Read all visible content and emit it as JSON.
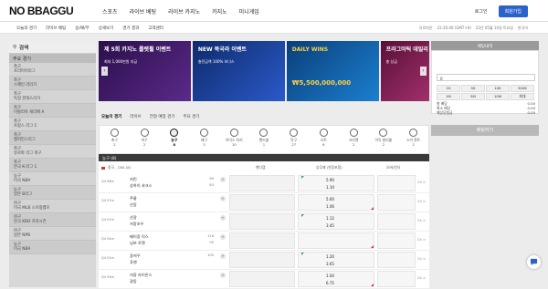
{
  "brand": {
    "logo": "NO BBAGGU"
  },
  "nav": [
    "스포츠",
    "라이브 베팅",
    "라이브 카지노",
    "카지노",
    "미니게임"
  ],
  "auth": {
    "login": "로그인",
    "join": "회원가입"
  },
  "subnav": [
    "오늘의 경기",
    "라이브 베팅",
    "승/패/무",
    "상세보기",
    "경기 결과",
    "고객센터"
  ],
  "subright": [
    "유로피안",
    "22:20:46 (GMT+9)",
    "22년 05월 14일 토요일",
    "한국어"
  ],
  "sidebar": {
    "search": "검색",
    "head": "주요 경기",
    "items": [
      {
        "label": "축구\n프리미어리그",
        "count": ""
      },
      {
        "label": "축구\n스페인 라리가",
        "count": ""
      },
      {
        "label": "축구\n독일 분데스리가",
        "count": ""
      },
      {
        "label": "축구\n이탈리아 세리에 A",
        "count": ""
      },
      {
        "label": "축구\n프랑스 리그 1",
        "count": ""
      },
      {
        "label": "축구\n챔피언스리그",
        "count": ""
      },
      {
        "label": "축구\n유로파 리그 축구",
        "count": ""
      },
      {
        "label": "축구\n한국 K-리그 1",
        "count": ""
      },
      {
        "label": "농구\n미국 NBA",
        "count": ""
      },
      {
        "label": "농구\n일본 B리그",
        "count": ""
      },
      {
        "label": "야구\n미국 MLB 스프링캠프",
        "count": ""
      },
      {
        "label": "야구\n한국 KBO 프리시즌",
        "count": ""
      },
      {
        "label": "야구\n일본 NPB",
        "count": ""
      },
      {
        "label": "농구\n미국 NBA",
        "count": ""
      }
    ]
  },
  "banners": [
    {
      "title": "제 5회 카지노 룰렛휠 이벤트",
      "sub": "최대 1,000만원 지급",
      "color": "#3a1a5c"
    },
    {
      "title": "NEW 북국라 이벤트",
      "sub": "충전금액 100% 보너스",
      "color": "#1e3a8a"
    },
    {
      "title": "DAILY WINS",
      "sub": "₩5,500,000,000",
      "color": "#0e5fa6"
    },
    {
      "title": "프라그마틱 데일리",
      "sub": "총 상금",
      "color": "#7a1a5a"
    }
  ],
  "tabs": [
    "오늘의 경기",
    "라이브",
    "전형 예정 경기",
    "주요 경기"
  ],
  "sports": [
    {
      "name": "축구",
      "count": "2"
    },
    {
      "name": "야구",
      "count": "2"
    },
    {
      "name": "농구",
      "count": "8"
    },
    {
      "name": "배구",
      "count": "3"
    },
    {
      "name": "아이스 하키",
      "count": "10"
    },
    {
      "name": "핸드볼",
      "count": "1"
    },
    {
      "name": "탁구",
      "count": "27"
    },
    {
      "name": "다트",
      "count": "6"
    },
    {
      "name": "크리켓",
      "count": "2"
    },
    {
      "name": "이익 발리볼",
      "count": "2"
    },
    {
      "name": "스키 퀸트",
      "count": "2"
    }
  ],
  "league_bar": "농구 (8)",
  "table_head": {
    "league": "중국 - CBA (8)",
    "col1": "핸디캡",
    "col2": "승무패 (연장포함)",
    "col3": "오버/언더"
  },
  "games": [
    {
      "time": "Q4 08m",
      "home": "지린",
      "away": "상하이 샤크스",
      "s1": "80",
      "s2": "83",
      "o1": "5.90",
      "o2": "1.10"
    },
    {
      "time": "Q4 07m",
      "home": "주룽",
      "away": "산동",
      "s1": "",
      "s2": "",
      "o1": "5.00",
      "o2": "1.06"
    },
    {
      "time": "Q4 07m",
      "home": "산장",
      "away": "저장조우",
      "s1": "",
      "s2": "",
      "o1": "1.12",
      "o2": "3.45"
    },
    {
      "time": "Q4 04m",
      "home": "베이징 덕스",
      "away": "닝보 로켓",
      "s1": "116",
      "s2": "95",
      "o1": "",
      "o2": ""
    },
    {
      "time": "Q4 01m",
      "home": "광저우",
      "away": "푸젠",
      "s1": "100",
      "s2": "",
      "o1": "1.20",
      "o2": "3.65"
    },
    {
      "time": "Q4 00m",
      "home": "저장 라이온스",
      "away": "광동",
      "s1": "",
      "s2": "",
      "o1": "1.04",
      "o2": "6.75"
    }
  ],
  "more": "24 >",
  "betslip": {
    "title": "베팅내역",
    "amount": "0",
    "chips": [
      "1K",
      "5K",
      "10K",
      "500K",
      "1M",
      "5M",
      "10M",
      "최대"
    ],
    "lines": [
      [
        "총 배당",
        "0.00"
      ],
      [
        "최소 배당",
        "0.00"
      ],
      [
        "예상당첨금",
        "0.00"
      ]
    ],
    "button": "베팅하기"
  }
}
